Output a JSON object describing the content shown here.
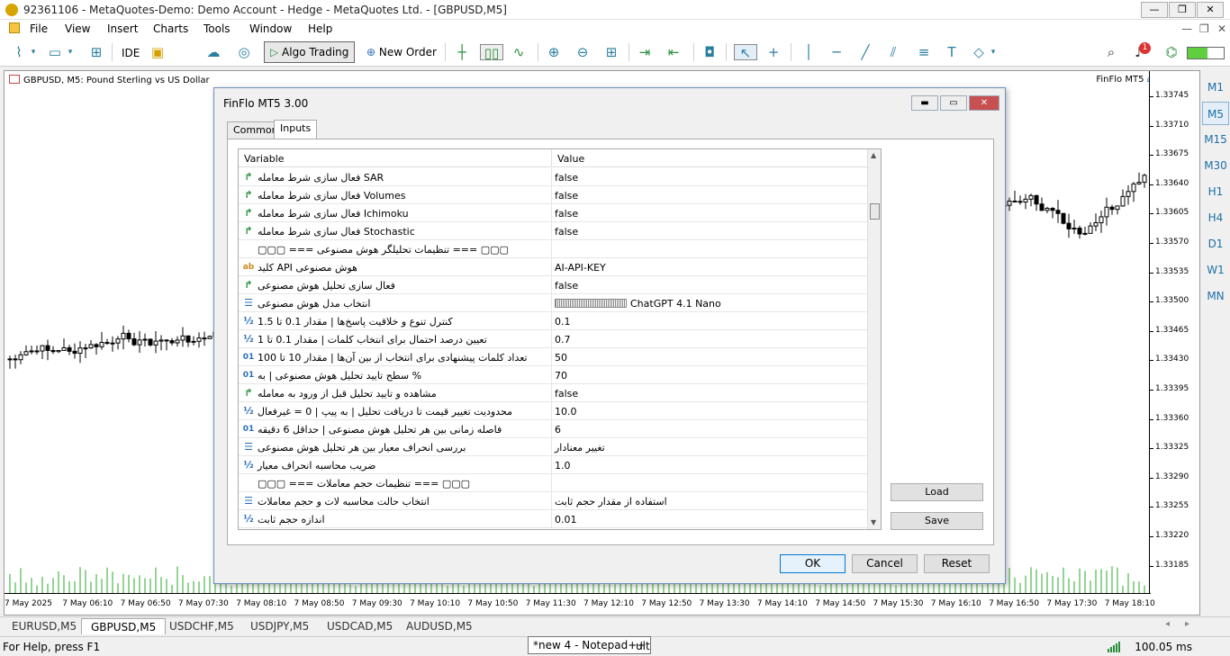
{
  "window": {
    "title": "92361106 - MetaQuotes-Demo: Demo Account - Hedge - MetaQuotes Ltd. - [GBPUSD,M5]",
    "minimize": "—",
    "restore": "❐",
    "close": "✕"
  },
  "menu": [
    "File",
    "View",
    "Insert",
    "Charts",
    "Tools",
    "Window",
    "Help"
  ],
  "toolbar": {
    "ide": "IDE",
    "algo_trading": "Algo Trading",
    "new_order": "New Order",
    "notifications": "1"
  },
  "chart": {
    "title": "GBPUSD, M5:  Pound Sterling vs US Dollar",
    "ea_name": "FinFlo MT5",
    "price_labels": [
      "1.33745",
      "1.33710",
      "1.33675",
      "1.33640",
      "1.33605",
      "1.33570",
      "1.33535",
      "1.33500",
      "1.33465",
      "1.33430",
      "1.33395",
      "1.33360",
      "1.33325",
      "1.33290",
      "1.33255",
      "1.33220",
      "1.33185"
    ],
    "time_labels": [
      "7 May 2025",
      "7 May 06:10",
      "7 May 06:50",
      "7 May 07:30",
      "7 May 08:10",
      "7 May 08:50",
      "7 May 09:30",
      "7 May 10:10",
      "7 May 10:50",
      "7 May 11:30",
      "7 May 12:10",
      "7 May 12:50",
      "7 May 13:30",
      "7 May 14:10",
      "7 May 14:50",
      "7 May 15:30",
      "7 May 16:10",
      "7 May 16:50",
      "7 May 17:30",
      "7 May 18:10"
    ]
  },
  "timeframes": [
    "M1",
    "M5",
    "M15",
    "M30",
    "H1",
    "H4",
    "D1",
    "W1",
    "MN"
  ],
  "symbol_tabs": [
    "EURUSD,M5",
    "GBPUSD,M5",
    "USDCHF,M5",
    "USDJPY,M5",
    "USDCAD,M5",
    "AUDUSD,M5"
  ],
  "status": {
    "help": "For Help, press F1",
    "ping": "100.05 ms",
    "tooltip": "*new 4 - Notepad++",
    "tooltip_tail": "ult"
  },
  "dialog": {
    "title": "FinFlo MT5 3.00",
    "tabs": [
      "Common",
      "Inputs"
    ],
    "col_variable": "Variable",
    "col_value": "Value",
    "rows": [
      {
        "type": "bool",
        "icon": "↱",
        "variable": "فعال سازی شرط معامله SAR",
        "value": "false"
      },
      {
        "type": "bool",
        "icon": "↱",
        "variable": "فعال سازی شرط معامله Volumes",
        "value": "false"
      },
      {
        "type": "bool",
        "icon": "↱",
        "variable": "فعال سازی شرط معامله Ichimoku",
        "value": "false"
      },
      {
        "type": "bool",
        "icon": "↱",
        "variable": "فعال سازی شرط معامله Stochastic",
        "value": "false"
      },
      {
        "type": "none",
        "icon": "",
        "variable": "▢▢▢ === تنظیمات تحلیلگر هوش مصنوعی === ▢▢▢",
        "value": ""
      },
      {
        "type": "str",
        "icon": "ab",
        "variable": "کلید API هوش مصنوعی",
        "value": "AI-API-KEY"
      },
      {
        "type": "bool",
        "icon": "↱",
        "variable": "فعال سازی تحلیل هوش مصنوعی",
        "value": "false"
      },
      {
        "type": "enum",
        "icon": "☰",
        "variable": "انتخاب مدل هوش مصنوعی",
        "value": "ChatGPT 4.1 Nano"
      },
      {
        "type": "dbl",
        "icon": "½",
        "variable": "کنترل تنوع و خلاقیت پاسخ‌ها | مقدار 0.1 تا 1.5",
        "value": "0.1"
      },
      {
        "type": "dbl",
        "icon": "½",
        "variable": "تعیین درصد احتمال برای انتخاب کلمات | مقدار 0.1 تا 1",
        "value": "0.7"
      },
      {
        "type": "int",
        "icon": "01",
        "variable": "تعداد کلمات پیشنهادی برای انتخاب از بین آن‌ها | مقدار 10 تا 100",
        "value": "50"
      },
      {
        "type": "int",
        "icon": "01",
        "variable": "سطح تایید تحلیل هوش مصنوعی | به %",
        "value": "70"
      },
      {
        "type": "bool",
        "icon": "↱",
        "variable": "مشاهده و تایید تحلیل قبل از ورود به معامله",
        "value": "false"
      },
      {
        "type": "dbl",
        "icon": "½",
        "variable": "محدودیت تغییر قیمت تا دریافت تحلیل | به پیپ | 0 = غیرفعال",
        "value": "10.0"
      },
      {
        "type": "int",
        "icon": "01",
        "variable": "فاصله زمانی بین هر تحلیل هوش مصنوعی | حداقل 6 دقیقه",
        "value": "6"
      },
      {
        "type": "enum",
        "icon": "☰",
        "variable": "بررسی انحراف معیار بین هر تحلیل هوش مصنوعی",
        "value": "تغییر معنادار"
      },
      {
        "type": "dbl",
        "icon": "½",
        "variable": "ضریب محاسبه انحراف معیار",
        "value": "1.0"
      },
      {
        "type": "none",
        "icon": "",
        "variable": "▢▢▢ === تنظیمات حجم معاملات === ▢▢▢",
        "value": ""
      },
      {
        "type": "enum",
        "icon": "☰",
        "variable": "انتخاب حالت محاسبه لات و حجم معاملات",
        "value": "استفاده از مقدار حجم ثابت"
      },
      {
        "type": "dbl",
        "icon": "½",
        "variable": "اندازه حجم ثابت",
        "value": "0.01"
      }
    ],
    "buttons": {
      "load": "Load",
      "save": "Save",
      "ok": "OK",
      "cancel": "Cancel",
      "reset": "Reset"
    }
  }
}
